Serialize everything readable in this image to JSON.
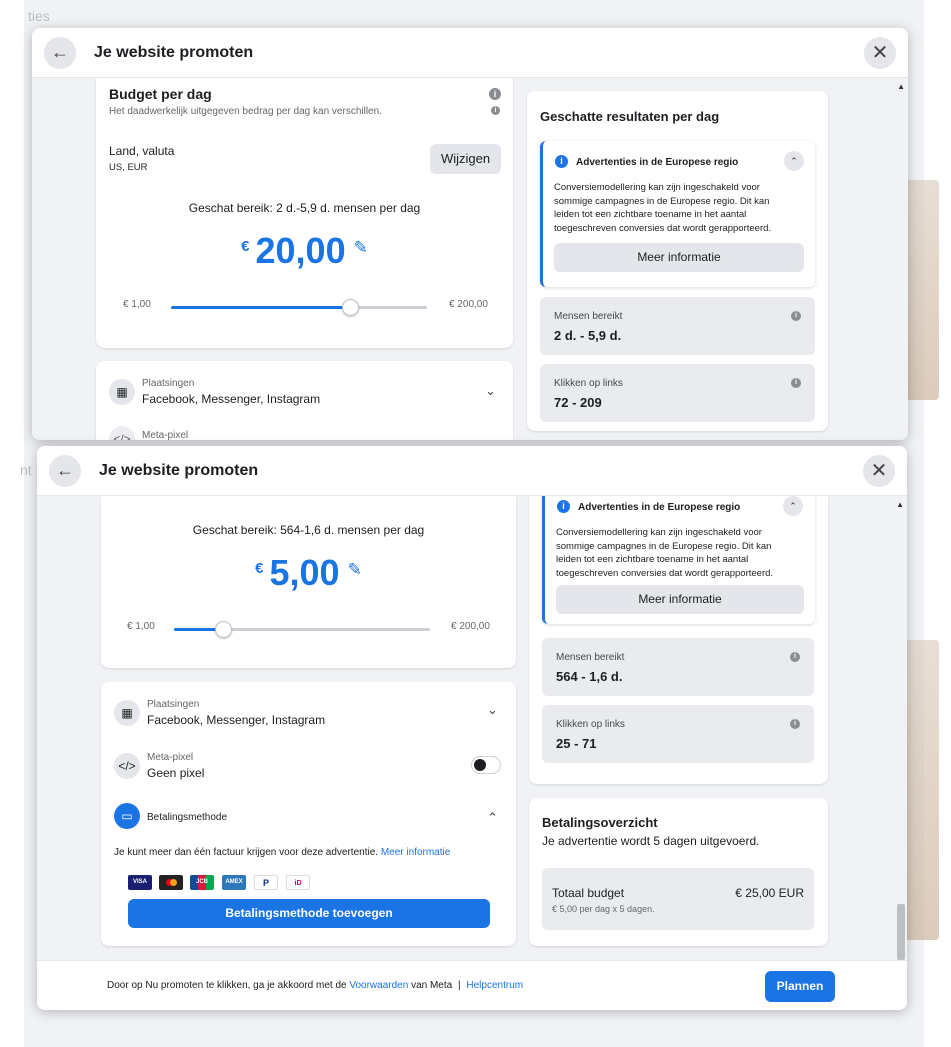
{
  "background": {
    "left_text_top": "ties",
    "left_text_bottom": "nt"
  },
  "top_dialog": {
    "title": "Je website promoten",
    "budget": {
      "title": "Budget per dag",
      "subtitle": "Het daadwerkelijk uitgegeven bedrag per dag kan verschillen.",
      "country_label": "Land, valuta",
      "country_value": "US, EUR",
      "change_button": "Wijzigen",
      "reach_text": "Geschat bereik: 2 d.-5,9 d. mensen per dag",
      "currency": "€",
      "amount": "20,00",
      "slider_min": "€ 1,00",
      "slider_max": "€ 200,00",
      "slider_fraction": 0.7
    },
    "placements": {
      "label": "Plaatsingen",
      "value": "Facebook, Messenger, Instagram"
    },
    "meta_pixel_label": "Meta-pixel",
    "results": {
      "title": "Geschatte resultaten per dag",
      "notice_title": "Advertenties in de Europese regio",
      "notice_text": "Conversiemodellering kan zijn ingeschakeld voor sommige campagnes in de Europese regio. Dit kan leiden tot een zichtbare toename in het aantal toegeschreven conversies dat wordt gerapporteerd.",
      "more_info_button": "Meer informatie",
      "people_reached_label": "Mensen bereikt",
      "people_reached_value": "2 d. - 5,9 d.",
      "link_clicks_label": "Klikken op links",
      "link_clicks_value": "72 - 209"
    }
  },
  "bottom_dialog": {
    "title": "Je website promoten",
    "budget": {
      "reach_text": "Geschat bereik: 564-1,6 d. mensen per dag",
      "currency": "€",
      "amount": "5,00",
      "slider_min": "€ 1,00",
      "slider_max": "€ 200,00",
      "slider_fraction": 0.19
    },
    "placements": {
      "label": "Plaatsingen",
      "value": "Facebook, Messenger, Instagram"
    },
    "meta_pixel": {
      "label": "Meta-pixel",
      "value": "Geen pixel",
      "toggle_on": false
    },
    "payment": {
      "label": "Betalingsmethode",
      "note": "Je kunt meer dan één factuur krijgen voor deze advertentie.",
      "note_link": "Meer informatie",
      "icons": [
        "VISA",
        "MC",
        "JCB",
        "AMEX",
        "PayPal",
        "iDEAL"
      ],
      "add_button": "Betalingsmethode toevoegen"
    },
    "results": {
      "notice_title": "Advertenties in de Europese regio",
      "notice_text": "Conversiemodellering kan zijn ingeschakeld voor sommige campagnes in de Europese regio. Dit kan leiden tot een zichtbare toename in het aantal toegeschreven conversies dat wordt gerapporteerd.",
      "more_info_button": "Meer informatie",
      "people_reached_label": "Mensen bereikt",
      "people_reached_value": "564 - 1,6 d.",
      "link_clicks_label": "Klikken op links",
      "link_clicks_value": "25 - 71"
    },
    "overview": {
      "title": "Betalingsoverzicht",
      "subtitle": "Je advertentie wordt 5 dagen uitgevoerd.",
      "total_label": "Totaal budget",
      "total_value": "€ 25,00 EUR",
      "total_detail": "€ 5,00 per dag x 5 dagen."
    },
    "footer": {
      "text_before": "Door op Nu promoten te klikken, ga je akkoord met de",
      "terms_link": "Voorwaarden",
      "text_after": "van Meta",
      "separator": "|",
      "help_link": "Helpcentrum",
      "schedule_button": "Plannen"
    }
  },
  "colors": {
    "accent": "#1b74e4",
    "page_bg": "#f0f2f5",
    "secondary_button": "#e4e6eb"
  }
}
